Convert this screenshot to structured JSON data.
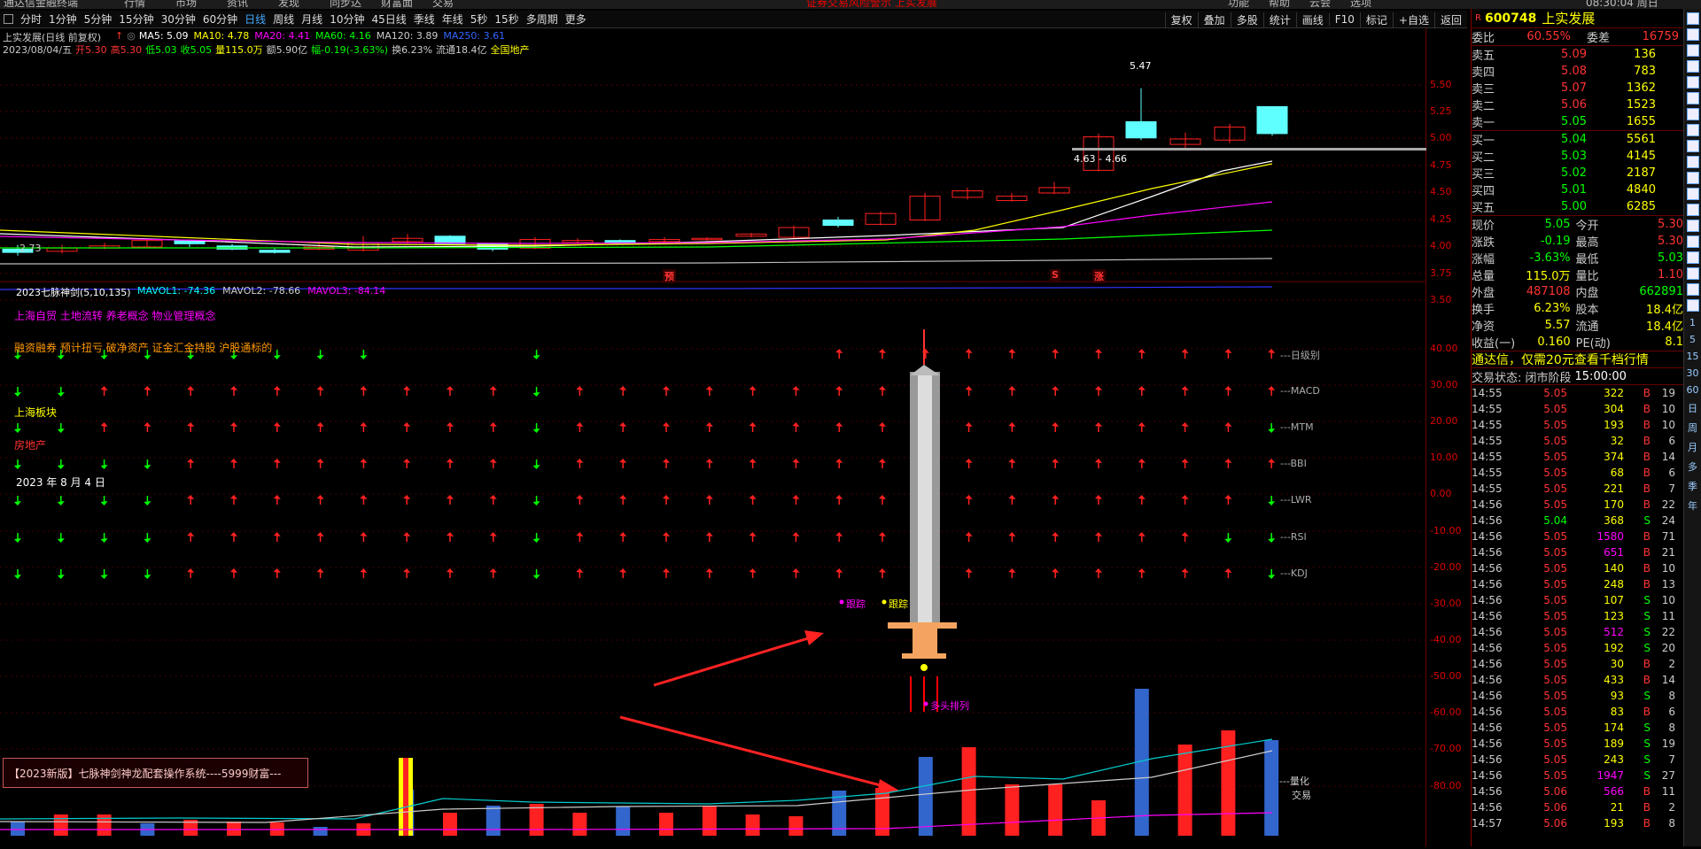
{
  "topbar": {
    "left_title": "通达信金融终端",
    "menus": [
      "行情",
      "市场",
      "资讯",
      "发现",
      "同步达",
      "财富面",
      "交易"
    ],
    "notice": "证券交易风险警示 上实发展",
    "right_menus": [
      "功能",
      "帮助",
      "云会",
      "选项"
    ],
    "clock": "08:30:04 周日"
  },
  "periods": [
    "分时",
    "1分钟",
    "5分钟",
    "15分钟",
    "30分钟",
    "60分钟",
    "日线",
    "周线",
    "月线",
    "10分钟",
    "45日线",
    "季线",
    "年线",
    "5秒",
    "15秒",
    "多周期",
    "更多"
  ],
  "active_period": "日线",
  "toolbar_right": [
    "复权",
    "叠加",
    "多股",
    "统计",
    "画线",
    "F10",
    "标记",
    "+自选",
    "返回"
  ],
  "chart": {
    "title": "上实发展(日线 前复权)",
    "ma_labels": [
      {
        "t": "MA5: 5.09",
        "c": "#fff"
      },
      {
        "t": "MA10: 4.78",
        "c": "#ff0"
      },
      {
        "t": "MA20: 4.41",
        "c": "#f0f"
      },
      {
        "t": "MA60: 4.16",
        "c": "#0f0"
      },
      {
        "t": "MA120: 3.89",
        "c": "#ccc"
      },
      {
        "t": "MA250: 3.61",
        "c": "#36f"
      }
    ],
    "info_line": [
      {
        "t": "2023/08/04/五",
        "c": "#ccc"
      },
      {
        "t": "开5.30",
        "c": "#f33"
      },
      {
        "t": "高5.30",
        "c": "#f33"
      },
      {
        "t": "低5.03",
        "c": "#0f0"
      },
      {
        "t": "收5.05",
        "c": "#0f0"
      },
      {
        "t": "量115.0万",
        "c": "#ff0"
      },
      {
        "t": "额5.90亿",
        "c": "#ccc"
      },
      {
        "t": "幅-0.19(-3.63%)",
        "c": "#0f0"
      },
      {
        "t": "换6.23%",
        "c": "#ccc"
      },
      {
        "t": "流通18.4亿",
        "c": "#ccc"
      },
      {
        "t": "全国地产",
        "c": "#ff0"
      }
    ],
    "high_label": "5.47",
    "low_label": "2.73",
    "range_label": "4.63 - 4.66",
    "markers": [
      "预",
      "S",
      "涨"
    ],
    "indicator_title": "2023七脉神剑(5,10,135)",
    "mavol": [
      {
        "t": "MAVOL1: -74.36",
        "c": "#0ff"
      },
      {
        "t": "MAVOL2: -78.66",
        "c": "#ccc"
      },
      {
        "t": "MAVOL3: -84.14",
        "c": "#f0f"
      }
    ],
    "concepts1": "上海自贸 土地流转 养老概念 物业管理概念",
    "concepts2": "融资融券 预计扭亏 破净资产 证金汇金持股 沪股通标的",
    "block_label": "上海板块",
    "sector_label": "房地产",
    "date_label": "2023 年 8 月 4 日",
    "row_labels": [
      "---日级别",
      "---MACD",
      "---MTM",
      "---BBI",
      "---LWR",
      "---RSI",
      "---KDJ"
    ],
    "track1": "跟踪",
    "track2": "跟踪",
    "duotou": "多头排列",
    "volume_labels": [
      "---量化",
      "交易"
    ],
    "banner": "【2023新版】七脉神剑神龙配套操作系统----5999财富---",
    "colors": {
      "up": "#ff2020",
      "down": "#00ff00",
      "cyan": "#60ffff",
      "blue": "#3366cc"
    }
  },
  "yaxis_price": [
    "5.50",
    "5.25",
    "5.00",
    "4.75",
    "4.50",
    "4.25",
    "4.00",
    "3.75",
    "3.50"
  ],
  "yaxis_ind": [
    "40.00",
    "30.00",
    "20.00",
    "10.00",
    "0.00",
    "-10.00",
    "-20.00",
    "-30.00",
    "-40.00",
    "-50.00",
    "-60.00",
    "-70.00",
    "-80.00"
  ],
  "quote": {
    "code": "600748",
    "name": "上实发展",
    "weibi_label": "委比",
    "weibi": "60.55%",
    "weicha_label": "委差",
    "weicha": "16759",
    "sells": [
      {
        "l": "卖五",
        "p": "5.09",
        "v": "136"
      },
      {
        "l": "卖四",
        "p": "5.08",
        "v": "783"
      },
      {
        "l": "卖三",
        "p": "5.07",
        "v": "1362"
      },
      {
        "l": "卖二",
        "p": "5.06",
        "v": "1523"
      },
      {
        "l": "卖一",
        "p": "5.05",
        "v": "1655"
      }
    ],
    "buys": [
      {
        "l": "买一",
        "p": "5.04",
        "v": "5561"
      },
      {
        "l": "买二",
        "p": "5.03",
        "v": "4145"
      },
      {
        "l": "买三",
        "p": "5.02",
        "v": "2187"
      },
      {
        "l": "买四",
        "p": "5.01",
        "v": "4840"
      },
      {
        "l": "买五",
        "p": "5.00",
        "v": "6285"
      }
    ],
    "stats": [
      [
        {
          "t": "现价",
          "c": "#ccc"
        },
        {
          "t": "5.05",
          "c": "#0f0"
        },
        {
          "t": "今开",
          "c": "#ccc"
        },
        {
          "t": "5.30",
          "c": "#f33"
        }
      ],
      [
        {
          "t": "涨跌",
          "c": "#ccc"
        },
        {
          "t": "-0.19",
          "c": "#0f0"
        },
        {
          "t": "最高",
          "c": "#ccc"
        },
        {
          "t": "5.30",
          "c": "#f33"
        }
      ],
      [
        {
          "t": "涨幅",
          "c": "#ccc"
        },
        {
          "t": "-3.63%",
          "c": "#0f0"
        },
        {
          "t": "最低",
          "c": "#ccc"
        },
        {
          "t": "5.03",
          "c": "#0f0"
        }
      ],
      [
        {
          "t": "总量",
          "c": "#ccc"
        },
        {
          "t": "115.0万",
          "c": "#ff0"
        },
        {
          "t": "量比",
          "c": "#ccc"
        },
        {
          "t": "1.10",
          "c": "#f33"
        }
      ],
      [
        {
          "t": "外盘",
          "c": "#ccc"
        },
        {
          "t": "487108",
          "c": "#f33"
        },
        {
          "t": "内盘",
          "c": "#ccc"
        },
        {
          "t": "662891",
          "c": "#0f0"
        }
      ],
      [
        {
          "t": "换手",
          "c": "#ccc"
        },
        {
          "t": "6.23%",
          "c": "#ff0"
        },
        {
          "t": "股本",
          "c": "#ccc"
        },
        {
          "t": "18.4亿",
          "c": "#ff0"
        }
      ],
      [
        {
          "t": "净资",
          "c": "#ccc"
        },
        {
          "t": "5.57",
          "c": "#ff0"
        },
        {
          "t": "流通",
          "c": "#ccc"
        },
        {
          "t": "18.4亿",
          "c": "#ff0"
        }
      ],
      [
        {
          "t": "收益(一)",
          "c": "#ccc"
        },
        {
          "t": "0.160",
          "c": "#ff0"
        },
        {
          "t": "PE(动)",
          "c": "#ccc"
        },
        {
          "t": "8.1",
          "c": "#ff0"
        }
      ]
    ],
    "ad": "通达信，仅需20元查看千档行情",
    "status_label": "交易状态: 闭市阶段",
    "status_time": "15:00:00",
    "ticks": [
      [
        "14:55",
        "5.05",
        "322",
        "B",
        "19"
      ],
      [
        "14:55",
        "5.05",
        "304",
        "B",
        "10"
      ],
      [
        "14:55",
        "5.05",
        "193",
        "B",
        "10"
      ],
      [
        "14:55",
        "5.05",
        "32",
        "B",
        "6"
      ],
      [
        "14:55",
        "5.05",
        "374",
        "B",
        "14"
      ],
      [
        "14:55",
        "5.05",
        "68",
        "B",
        "6"
      ],
      [
        "14:55",
        "5.05",
        "221",
        "B",
        "7"
      ],
      [
        "14:56",
        "5.05",
        "170",
        "B",
        "22"
      ],
      [
        "14:56",
        "5.04",
        "368",
        "S",
        "24"
      ],
      [
        "14:56",
        "5.05",
        "1580",
        "B",
        "71"
      ],
      [
        "14:56",
        "5.05",
        "651",
        "B",
        "21"
      ],
      [
        "14:56",
        "5.05",
        "140",
        "B",
        "10"
      ],
      [
        "14:56",
        "5.05",
        "248",
        "B",
        "13"
      ],
      [
        "14:56",
        "5.05",
        "107",
        "S",
        "10"
      ],
      [
        "14:56",
        "5.05",
        "123",
        "S",
        "11"
      ],
      [
        "14:56",
        "5.05",
        "512",
        "S",
        "22"
      ],
      [
        "14:56",
        "5.05",
        "192",
        "S",
        "20"
      ],
      [
        "14:56",
        "5.05",
        "30",
        "B",
        "2"
      ],
      [
        "14:56",
        "5.05",
        "433",
        "B",
        "14"
      ],
      [
        "14:56",
        "5.05",
        "93",
        "S",
        "8"
      ],
      [
        "14:56",
        "5.05",
        "83",
        "B",
        "6"
      ],
      [
        "14:56",
        "5.05",
        "174",
        "S",
        "8"
      ],
      [
        "14:56",
        "5.05",
        "189",
        "S",
        "19"
      ],
      [
        "14:56",
        "5.05",
        "243",
        "S",
        "7"
      ],
      [
        "14:56",
        "5.05",
        "1947",
        "S",
        "27"
      ],
      [
        "14:56",
        "5.06",
        "566",
        "B",
        "11"
      ],
      [
        "14:56",
        "5.06",
        "21",
        "B",
        "2"
      ],
      [
        "14:57",
        "5.06",
        "193",
        "B",
        "8"
      ]
    ]
  },
  "side_labels": [
    "1",
    "5",
    "15",
    "30",
    "60",
    "日",
    "周",
    "月",
    "多",
    "季",
    "年"
  ]
}
